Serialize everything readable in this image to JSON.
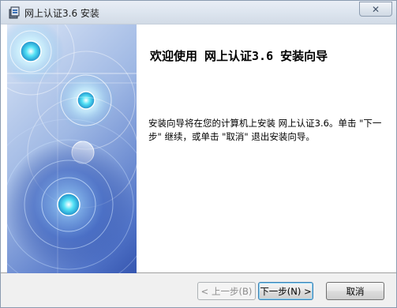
{
  "window": {
    "title": "网上认证3.6 安装",
    "close_glyph": "✕"
  },
  "main": {
    "heading": "欢迎使用 网上认证3.6 安装向导",
    "body": "安装向导将在您的计算机上安装 网上认证3.6。单击 \"下一步\" 继续，或单击 \"取消\" 退出安装向导。"
  },
  "buttons": {
    "back": "< 上一步(B)",
    "next": "下一步(N) >",
    "cancel": "取消"
  },
  "colors": {
    "art_dark": "#3656b0",
    "art_light": "#dbe6f6",
    "accent_cyan": "#2fd0e8"
  }
}
